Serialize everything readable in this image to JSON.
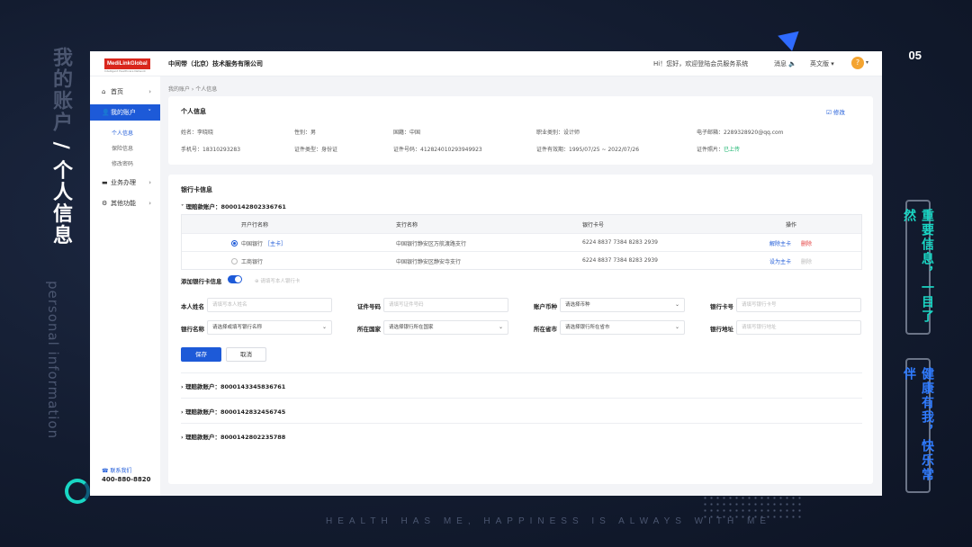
{
  "slide": {
    "title_part1": "我的账户",
    "title_sep": "/",
    "title_part2": "个人信息",
    "subtitle_en": "personal information",
    "number": "05",
    "tagline": "HEALTH HAS ME, HAPPINESS IS ALWAYS WITH ME",
    "badge1": "重要信息，一目了然",
    "badge2": "健康有我，快乐常伴"
  },
  "topbar": {
    "logo": "MediLinkGlobal",
    "logo_sub": "Intelligent Healthcare Network",
    "company": "中间带（北京）技术服务有限公司",
    "welcome": "Hi！您好，欢迎登陆会员服务系统",
    "messages": "消息 🔈",
    "language": "英文版 ▾",
    "avatar": "?",
    "avatar_caret": "▾"
  },
  "sidebar": {
    "items": [
      {
        "label": "首页",
        "icon": "⌂",
        "chev": "›"
      },
      {
        "label": "我的账户",
        "icon": "👤",
        "chev": "˅"
      },
      {
        "label": "业务办理",
        "icon": "▬",
        "chev": "›"
      },
      {
        "label": "其他功能",
        "icon": "⚙",
        "chev": "›"
      }
    ],
    "sub_items": [
      "个人信息",
      "保险信息",
      "修改密码"
    ],
    "contact": "☎ 联系我们",
    "phone": "400-880-8820"
  },
  "breadcrumb": "我的账户 › 个人信息",
  "personal": {
    "title": "个人信息",
    "edit": "☑ 修改",
    "row1": [
      {
        "label": "姓名：",
        "value": "李晓晓"
      },
      {
        "label": "性别：",
        "value": "男"
      },
      {
        "label": "国籍：",
        "value": "中国"
      },
      {
        "label": "职业类别：",
        "value": "设计师"
      },
      {
        "label": "电子邮箱：",
        "value": "2289328920@qq.com"
      }
    ],
    "row2": [
      {
        "label": "手机号：",
        "value": "18310293283"
      },
      {
        "label": "证件类型：",
        "value": "身份证"
      },
      {
        "label": "证件号码：",
        "value": "412824010293949923"
      },
      {
        "label": "证件有效期：",
        "value": "1995/07/25 ~ 2022/07/26"
      },
      {
        "label": "证件照片：",
        "value": "已上传"
      }
    ]
  },
  "bank": {
    "title": "银行卡信息",
    "active_account": "˅ 理赔款账户：8000142802336761",
    "columns": [
      "开户行名称",
      "支行名称",
      "银行卡号",
      "操作"
    ],
    "rows": [
      {
        "bank": "中国银行",
        "main_tag": "［主卡］",
        "branch": "中国银行静安区万航渡路支行",
        "card": "6224 8837 7384 8283 2939",
        "op1": "解除主卡",
        "op2": "删除"
      },
      {
        "bank": "工商银行",
        "main_tag": "",
        "branch": "中国银行静安区静安寺支行",
        "card": "6224 8837 7384 8283 2939",
        "op1": "设为主卡",
        "op2": "删除"
      }
    ],
    "add_label": "添加银行卡信息",
    "add_hint": "⊕ 请填写本人银行卡",
    "form": {
      "name_label": "本人姓名",
      "name_ph": "请填写本人姓名",
      "id_label": "证件号码",
      "id_ph": "请填写证件号码",
      "currency_label": "账户币种",
      "currency_val": "请选择币种",
      "card_label": "银行卡号",
      "card_ph": "请填写银行卡号",
      "bank_label": "银行名称",
      "bank_val": "请选择或填写银行名称",
      "country_label": "所在国家",
      "country_val": "请选择银行所在国家",
      "province_label": "所在省市",
      "province_val": "请选择银行所在省市",
      "addr_label": "银行地址",
      "addr_ph": "请填写银行地址",
      "caret": "⌄"
    },
    "save": "保存",
    "cancel": "取消",
    "other_accounts": [
      "› 理赔款账户：8000143345836761",
      "› 理赔款账户：8000142832456745",
      "› 理赔款账户：8000142802235788"
    ]
  },
  "colors": {
    "primary": "#1d5ad8",
    "danger": "#e33a3a",
    "success": "#14b36b",
    "accent": "#19d6c4"
  }
}
